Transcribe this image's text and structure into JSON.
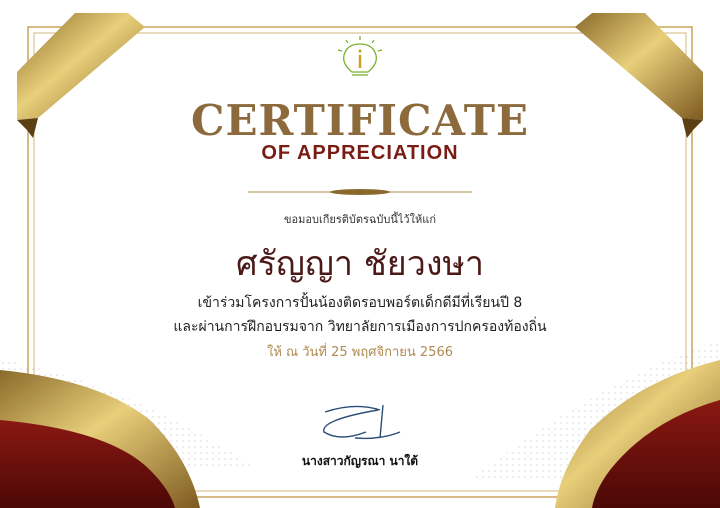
{
  "certificate": {
    "title": "CERTIFICATE",
    "subtitle": "OF APPRECIATION",
    "presented_to_label": "ขอมอบเกียรติบัตรฉบับนี้ไว้ให้แก่",
    "recipient_name": "ศรัญญา ชัยวงษา",
    "description_line1": "เข้าร่วมโครงการปั้นน้องติดรอบพอร์ตเด็กดีมีที่เรียนปี 8",
    "description_line2": "และผ่านการฝึกอบรมจาก วิทยาลัยการเมืองการปกครองท้องถิ่น",
    "date_line": "ให้ ณ วันที่ 25 พฤศจิกายน 2566",
    "signer_name": "นางสาวกัญรณา นาใต้",
    "logo_icon": "lightbulb-info-icon"
  },
  "colors": {
    "gold": "#c9a55a",
    "maroon": "#6e0f0c",
    "title": "#8c6a3c",
    "subtitle": "#7a1c14"
  }
}
